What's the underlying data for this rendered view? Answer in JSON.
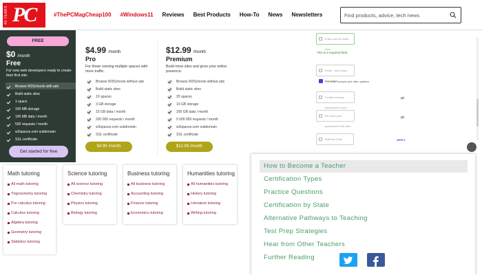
{
  "header": {
    "logo_years": "40 YEARS",
    "logo_text": "PC",
    "nav": [
      {
        "label": "#ThePCMagCheap100",
        "style": "red"
      },
      {
        "label": "#Windows11",
        "style": "red"
      },
      {
        "label": "Reviews",
        "style": "plain"
      },
      {
        "label": "Best Products",
        "style": "plain"
      },
      {
        "label": "How-To",
        "style": "plain"
      },
      {
        "label": "News",
        "style": "plain"
      },
      {
        "label": "Newsletters",
        "style": "plain"
      }
    ],
    "search_placeholder": "Find products, advice, tech news"
  },
  "pricing": {
    "free": {
      "badge": "FREE",
      "price": "$0",
      "unit": "/month",
      "name": "Free",
      "desc": "For new web developers ready to create their first site.",
      "features": [
        "Browse W3Schools with ads",
        "Build static sites",
        "1 space",
        "100 MB storage",
        "100 MB data / month",
        "500 requests / month",
        "w3spaces.com subdomain",
        "SSL certificate"
      ],
      "cta": "Get started for free"
    },
    "pro": {
      "price": "$4.99",
      "unit": "/month",
      "name": "Pro",
      "desc": "For those running multiple spaces with more traffic.",
      "features": [
        "Browse W3Schools without ads",
        "Build static sites",
        "10 spaces",
        "3 GB storage",
        "15 GB data / month",
        "200 000 requests / month",
        "w3spaces.com subdomain",
        "SSL certificate"
      ],
      "cta": "$4.99 /month"
    },
    "premium": {
      "price": "$12.99",
      "unit": "/month",
      "name": "Premium",
      "desc": "Build more sites and grow your online presence.",
      "features": [
        "Browse W3Schools without ads",
        "Build static sites",
        "25 spaces",
        "10 GB storage",
        "200 GB data / month",
        "5 000 000 requests / month",
        "w3spaces.com subdomain",
        "SSL certificate"
      ],
      "cta": "$12.99 /month"
    }
  },
  "tutoring": [
    {
      "title": "Math tutoring",
      "links": [
        "All math tutoring",
        "Trigonometry tutoring",
        "Pre calculus tutoring",
        "Calculus tutoring",
        "Algebra tutoring",
        "Geometry tutoring",
        "Statistics tutoring"
      ]
    },
    {
      "title": "Science tutoring",
      "links": [
        "All science tutoring",
        "Chemistry tutoring",
        "Physics tutoring",
        "Biology tutoring"
      ]
    },
    {
      "title": "Business tutoring",
      "links": [
        "All business tutoring",
        "Accounting tutoring",
        "Finance tutoring",
        "Economics tutoring"
      ]
    },
    {
      "title": "Humanities tutoring",
      "links": [
        "All humanities tutoring",
        "History tutoring",
        "Literature tutoring",
        "Writing tutoring"
      ]
    }
  ],
  "form": {
    "fullname_placeholder": "Enter you full name here",
    "required_msg": "This is a required field.",
    "email_placeholder": "Email - this is your username",
    "optin": "For order receipts and offer updates.",
    "password_placeholder": "Create a strong password for your security",
    "reenter_placeholder": "Re-enter your password in this field",
    "referral_placeholder": "Referral Code",
    "apply_label": "APPLY"
  },
  "teacher_menu": {
    "items": [
      "How to Become a Teacher",
      "Certification Types",
      "Practice Questions",
      "Certification by State",
      "Alternative Pathways to Teaching",
      "Test Prep Strategies",
      "Hear from Other Teachers",
      "Further Reading"
    ]
  },
  "social": {
    "twitter_color": "#1da1f2",
    "facebook_color": "#3b5998"
  }
}
